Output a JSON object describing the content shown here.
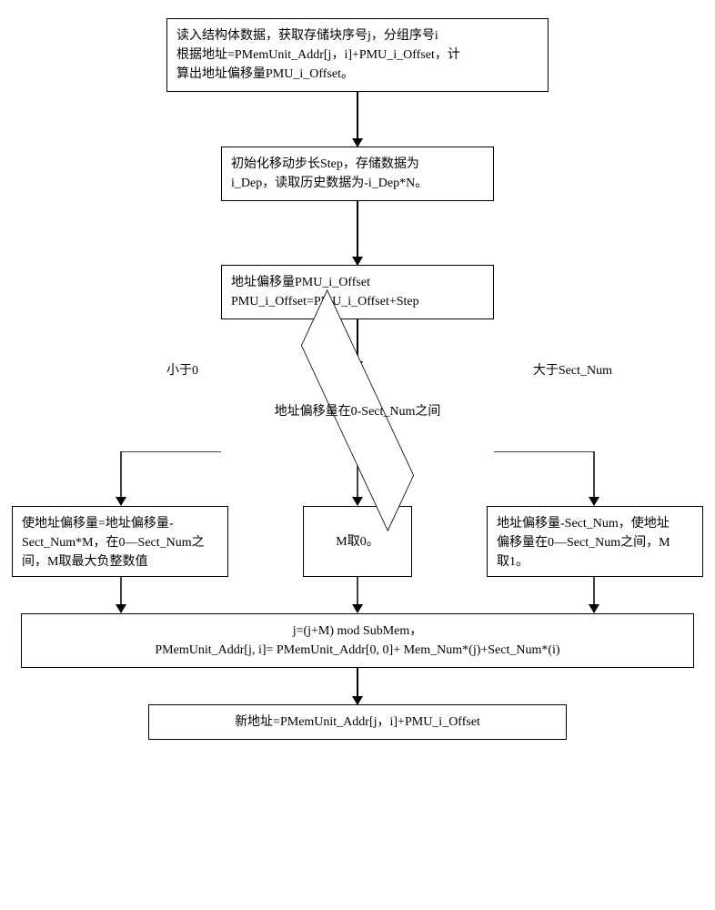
{
  "flow": {
    "step1": "读入结构体数据，获取存储块序号j，分组序号i\n根据地址=PMemUnit_Addr[j，i]+PMU_i_Offset，计\n算出地址偏移量PMU_i_Offset。",
    "step2": "初始化移动步长Step，存储数据为\ni_Dep，读取历史数据为-i_Dep*N。",
    "step3": "地址偏移量PMU_i_Offset\nPMU_i_Offset=PMU_i_Offset+Step",
    "decision": "地址偏移量在0-Sect_Num之间",
    "labels": {
      "left": "小于0",
      "right": "大于Sect_Num"
    },
    "branch_left": "使地址偏移量=地址偏移量-\nSect_Num*M，在0—Sect_Num之\n间，M取最大负整数值",
    "branch_mid": "M取0。",
    "branch_right": "地址偏移量-Sect_Num，使地址\n偏移量在0—Sect_Num之间，M\n取1。",
    "step5": "j=(j+M) mod SubMem，\nPMemUnit_Addr[j, i]= PMemUnit_Addr[0, 0]+ Mem_Num*(j)+Sect_Num*(i)",
    "step6": "新地址=PMemUnit_Addr[j，i]+PMU_i_Offset"
  }
}
